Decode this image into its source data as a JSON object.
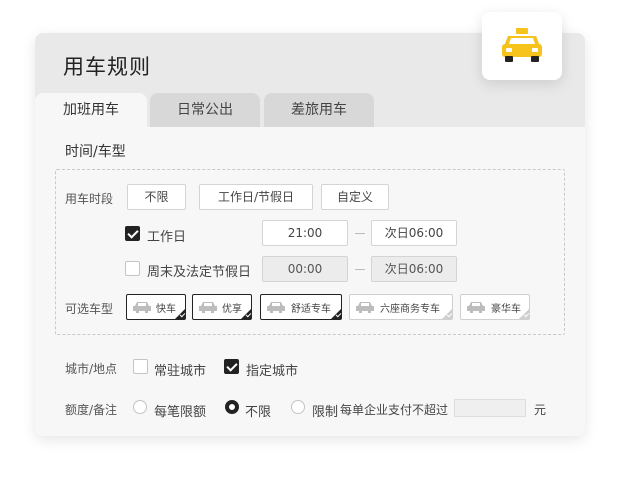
{
  "card": {
    "title": "用车规则"
  },
  "tabs": [
    {
      "label": "加班用车",
      "active": true
    },
    {
      "label": "日常公出",
      "active": false
    },
    {
      "label": "差旅用车",
      "active": false
    }
  ],
  "section": {
    "title": "时间/车型"
  },
  "period": {
    "label": "用车时段",
    "options": [
      "不限",
      "工作日/节假日",
      "自定义"
    ],
    "rows": [
      {
        "label": "工作日",
        "checked": true,
        "start": "21:00",
        "end": "次日06:00",
        "disabled": false
      },
      {
        "label": "周末及法定节假日",
        "checked": false,
        "start": "00:00",
        "end": "次日06:00",
        "disabled": true
      }
    ]
  },
  "car_types": {
    "label": "可选车型",
    "items": [
      {
        "name": "快车",
        "selected": true
      },
      {
        "name": "优享",
        "selected": true
      },
      {
        "name": "舒适专车",
        "selected": true
      },
      {
        "name": "六座商务专车",
        "selected": false
      },
      {
        "name": "豪华车",
        "selected": false
      }
    ]
  },
  "city": {
    "label": "城市/地点",
    "options": [
      {
        "label": "常驻城市",
        "checked": false
      },
      {
        "label": "指定城市",
        "checked": true
      }
    ]
  },
  "quota": {
    "label": "额度/备注",
    "options": [
      {
        "label": "每笔限额",
        "selected": false
      },
      {
        "label": "不限",
        "selected": true
      },
      {
        "label": "限制",
        "selected": false
      }
    ],
    "limit_text": "每单企业支付不超过",
    "amount_value": "",
    "unit": "元"
  },
  "colors": {
    "taxi": "#f6c21c",
    "accent": "#222222"
  },
  "icons": {
    "taxi": "taxi-icon",
    "car": "car-icon"
  }
}
